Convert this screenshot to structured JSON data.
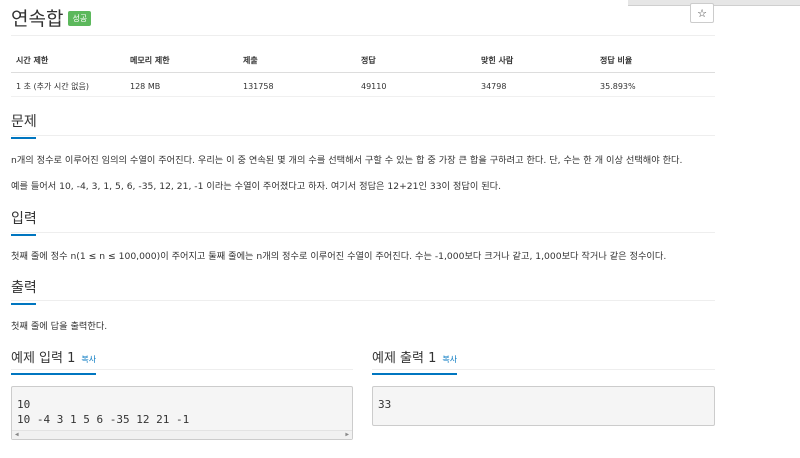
{
  "problem": {
    "title": "연속합",
    "badge": "성공",
    "star_icon": "☆"
  },
  "stats": {
    "headers": [
      "시간 제한",
      "메모리 제한",
      "제출",
      "정답",
      "맞힌 사람",
      "정답 비율"
    ],
    "values": [
      "1 초 (추가 시간 없음)",
      "128 MB",
      "131758",
      "49110",
      "34798",
      "35.893%"
    ]
  },
  "sections": {
    "description": {
      "heading": "문제",
      "lines": [
        "n개의 정수로 이루어진 임의의 수열이 주어진다. 우리는 이 중 연속된 몇 개의 수를 선택해서 구할 수 있는 합 중 가장 큰 합을 구하려고 한다. 단, 수는 한 개 이상 선택해야 한다.",
        "예를 들어서 10, -4, 3, 1, 5, 6, -35, 12, 21, -1 이라는 수열이 주어졌다고 하자. 여기서 정답은 12+21인 33이 정답이 된다."
      ]
    },
    "input": {
      "heading": "입력",
      "lines": [
        "첫째 줄에 정수 n(1 ≤ n ≤ 100,000)이 주어지고 둘째 줄에는 n개의 정수로 이루어진 수열이 주어진다. 수는 -1,000보다 크거나 같고, 1,000보다 작거나 같은 정수이다."
      ]
    },
    "output": {
      "heading": "출력",
      "lines": [
        "첫째 줄에 답을 출력한다."
      ]
    }
  },
  "examples": {
    "input": {
      "heading": "예제 입력 1",
      "copy_label": "복사",
      "lines": [
        "10",
        "10 -4 3 1 5 6 -35 12 21 -1"
      ]
    },
    "output": {
      "heading": "예제 출력 1",
      "copy_label": "복사",
      "lines": [
        "33"
      ]
    },
    "scroll_left": "◀",
    "scroll_right": "▶"
  }
}
